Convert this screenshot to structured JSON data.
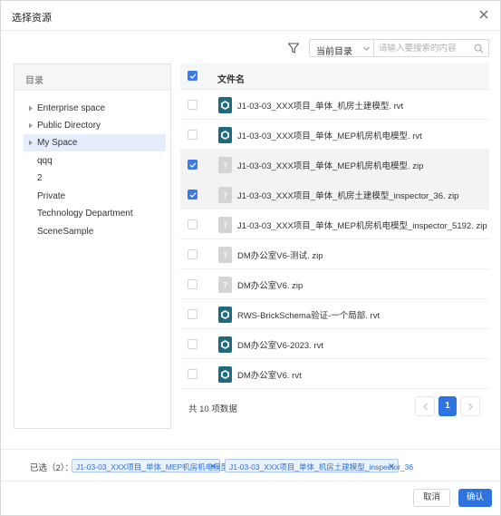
{
  "dialog": {
    "title": "选择资源"
  },
  "toolbar": {
    "scope_value": "当前目录",
    "search_placeholder": "请输入要搜索的内容"
  },
  "tree": {
    "header": "目录",
    "items": [
      {
        "label": "Enterprise space",
        "has_children": true,
        "selected": false
      },
      {
        "label": "Public Directory",
        "has_children": true,
        "selected": false
      },
      {
        "label": "My Space",
        "has_children": true,
        "selected": true
      },
      {
        "label": "qqq",
        "has_children": false,
        "selected": false
      },
      {
        "label": "2",
        "has_children": false,
        "selected": false
      },
      {
        "label": "Private",
        "has_children": false,
        "selected": false
      },
      {
        "label": "Technology Department",
        "has_children": false,
        "selected": false
      },
      {
        "label": "SceneSample",
        "has_children": false,
        "selected": false
      }
    ]
  },
  "files": {
    "column_header": "文件名",
    "rows": [
      {
        "name": "J1-03-03_XXX项目_单体_机房土建模型. rvt",
        "icon": "revit-model-icon",
        "checked": false
      },
      {
        "name": "J1-03-03_XXX项目_单体_MEP机房机电模型. rvt",
        "icon": "revit-model-icon",
        "checked": false
      },
      {
        "name": "J1-03-03_XXX项目_单体_MEP机房机电模型. zip",
        "icon": "unknown-file-icon",
        "checked": true
      },
      {
        "name": "J1-03-03_XXX项目_单体_机房土建模型_inspector_36. zip",
        "icon": "unknown-file-icon",
        "checked": true
      },
      {
        "name": "J1-03-03_XXX项目_单体_MEP机房机电模型_inspector_5192. zip",
        "icon": "unknown-file-icon",
        "checked": false
      },
      {
        "name": "DM办公室V6-测试. zip",
        "icon": "unknown-file-icon",
        "checked": false
      },
      {
        "name": "DM办公室V6. zip",
        "icon": "unknown-file-icon",
        "checked": false
      },
      {
        "name": "RWS-BrickSchema验证-一个局部. rvt",
        "icon": "revit-model-icon",
        "checked": false
      },
      {
        "name": "DM办公室V6-2023. rvt",
        "icon": "revit-model-icon",
        "checked": false
      },
      {
        "name": "DM办公室V6. rvt",
        "icon": "revit-model-icon",
        "checked": false
      }
    ]
  },
  "pager": {
    "total_text": "共 10 项数据",
    "current_page": "1"
  },
  "selection": {
    "label": "已选（2）：",
    "tags": [
      "J1-03-03_XXX项目_单体_MEP机房机电模型",
      "J1-03-03_XXX项目_单体_机房土建模型_inspector_36"
    ]
  },
  "footer": {
    "cancel_label": "取消",
    "confirm_label": "确认"
  },
  "colors": {
    "accent": "#2f73e0",
    "checkbox_on": "#3a7be8",
    "tag_text": "#2f6fd6",
    "model_icon": "#1f6a7c"
  }
}
